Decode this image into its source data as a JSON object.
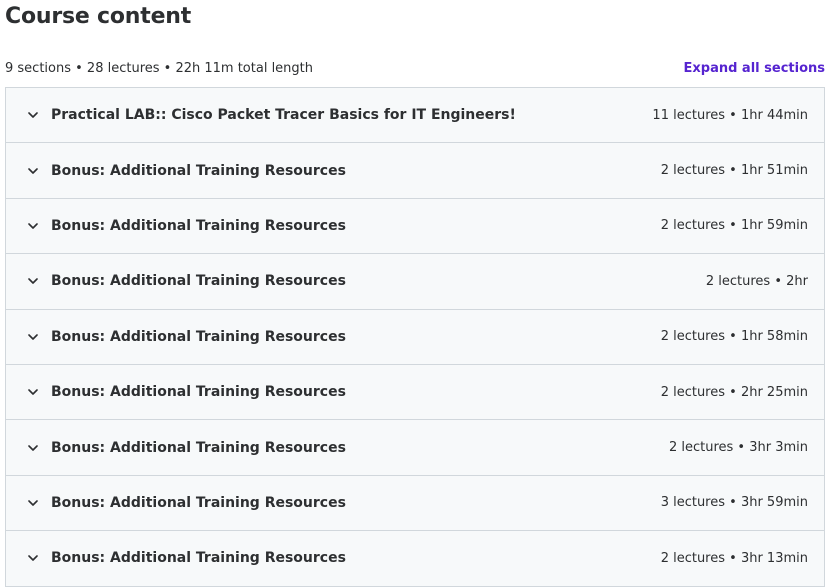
{
  "header": {
    "title": "Course content",
    "summary": "9 sections • 28 lectures • 22h 11m total length",
    "expand_all": "Expand all sections"
  },
  "icons": {
    "chevron": "chevron-down-icon"
  },
  "colors": {
    "accent": "#5624d0",
    "section_bg": "#f7f9fa",
    "border": "#d1d7dc",
    "text": "#2d2f31"
  },
  "sections": [
    {
      "title": "Practical LAB:: Cisco Packet Tracer Basics for IT Engineers!",
      "meta": "11 lectures • 1hr 44min"
    },
    {
      "title": "Bonus: Additional Training Resources",
      "meta": "2 lectures • 1hr 51min"
    },
    {
      "title": "Bonus: Additional Training Resources",
      "meta": "2 lectures • 1hr 59min"
    },
    {
      "title": "Bonus: Additional Training Resources",
      "meta": "2 lectures • 2hr"
    },
    {
      "title": "Bonus: Additional Training Resources",
      "meta": "2 lectures • 1hr 58min"
    },
    {
      "title": "Bonus: Additional Training Resources",
      "meta": "2 lectures • 2hr 25min"
    },
    {
      "title": "Bonus: Additional Training Resources",
      "meta": "2 lectures • 3hr 3min"
    },
    {
      "title": "Bonus: Additional Training Resources",
      "meta": "3 lectures • 3hr 59min"
    },
    {
      "title": "Bonus: Additional Training Resources",
      "meta": "2 lectures • 3hr 13min"
    }
  ]
}
